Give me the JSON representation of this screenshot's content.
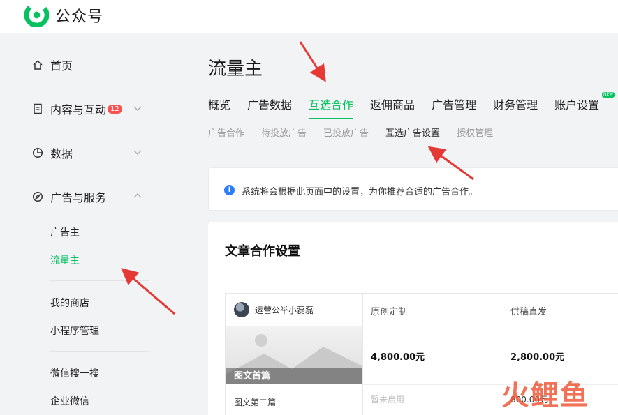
{
  "app": {
    "title": "公众号",
    "brand_color": "#07c160",
    "logo_icon": "wechat-official-account-logo"
  },
  "sidebar": {
    "items": [
      {
        "label": "首页",
        "icon": "home-icon"
      },
      {
        "label": "内容与互动",
        "icon": "document-icon",
        "badge": "12"
      },
      {
        "label": "数据",
        "icon": "pie-chart-icon"
      },
      {
        "label": "广告与服务",
        "icon": "compass-icon"
      }
    ],
    "sub_items": [
      "广告主",
      "流量主",
      "我的商店",
      "小程序管理",
      "微信搜一搜",
      "企业微信"
    ],
    "active_sub": "流量主"
  },
  "main": {
    "title": "流量主",
    "tabs": [
      {
        "label": "概览"
      },
      {
        "label": "广告数据"
      },
      {
        "label": "互选合作",
        "active": true
      },
      {
        "label": "返佣商品"
      },
      {
        "label": "广告管理"
      },
      {
        "label": "财务管理"
      },
      {
        "label": "账户设置",
        "tag": "NEW"
      }
    ],
    "subtabs": [
      {
        "label": "广告合作"
      },
      {
        "label": "待投放广告"
      },
      {
        "label": "已投放广告"
      },
      {
        "label": "互选广告设置",
        "active": true
      },
      {
        "label": "授权管理"
      }
    ],
    "notice": "系统将会根据此页面中的设置，为你推荐合适的广告合作。",
    "card": {
      "title": "文章合作设置",
      "account": "运营公举小磊磊",
      "cover_caption": "图文首篇",
      "second_article": "图文第二篇",
      "headers": [
        "原创定制",
        "供稿直发"
      ],
      "first_prices": [
        "4,800.00元",
        "2,800.00元"
      ],
      "second_row": [
        "暂未启用",
        "800.00元"
      ]
    }
  },
  "watermark": "火鲤鱼"
}
